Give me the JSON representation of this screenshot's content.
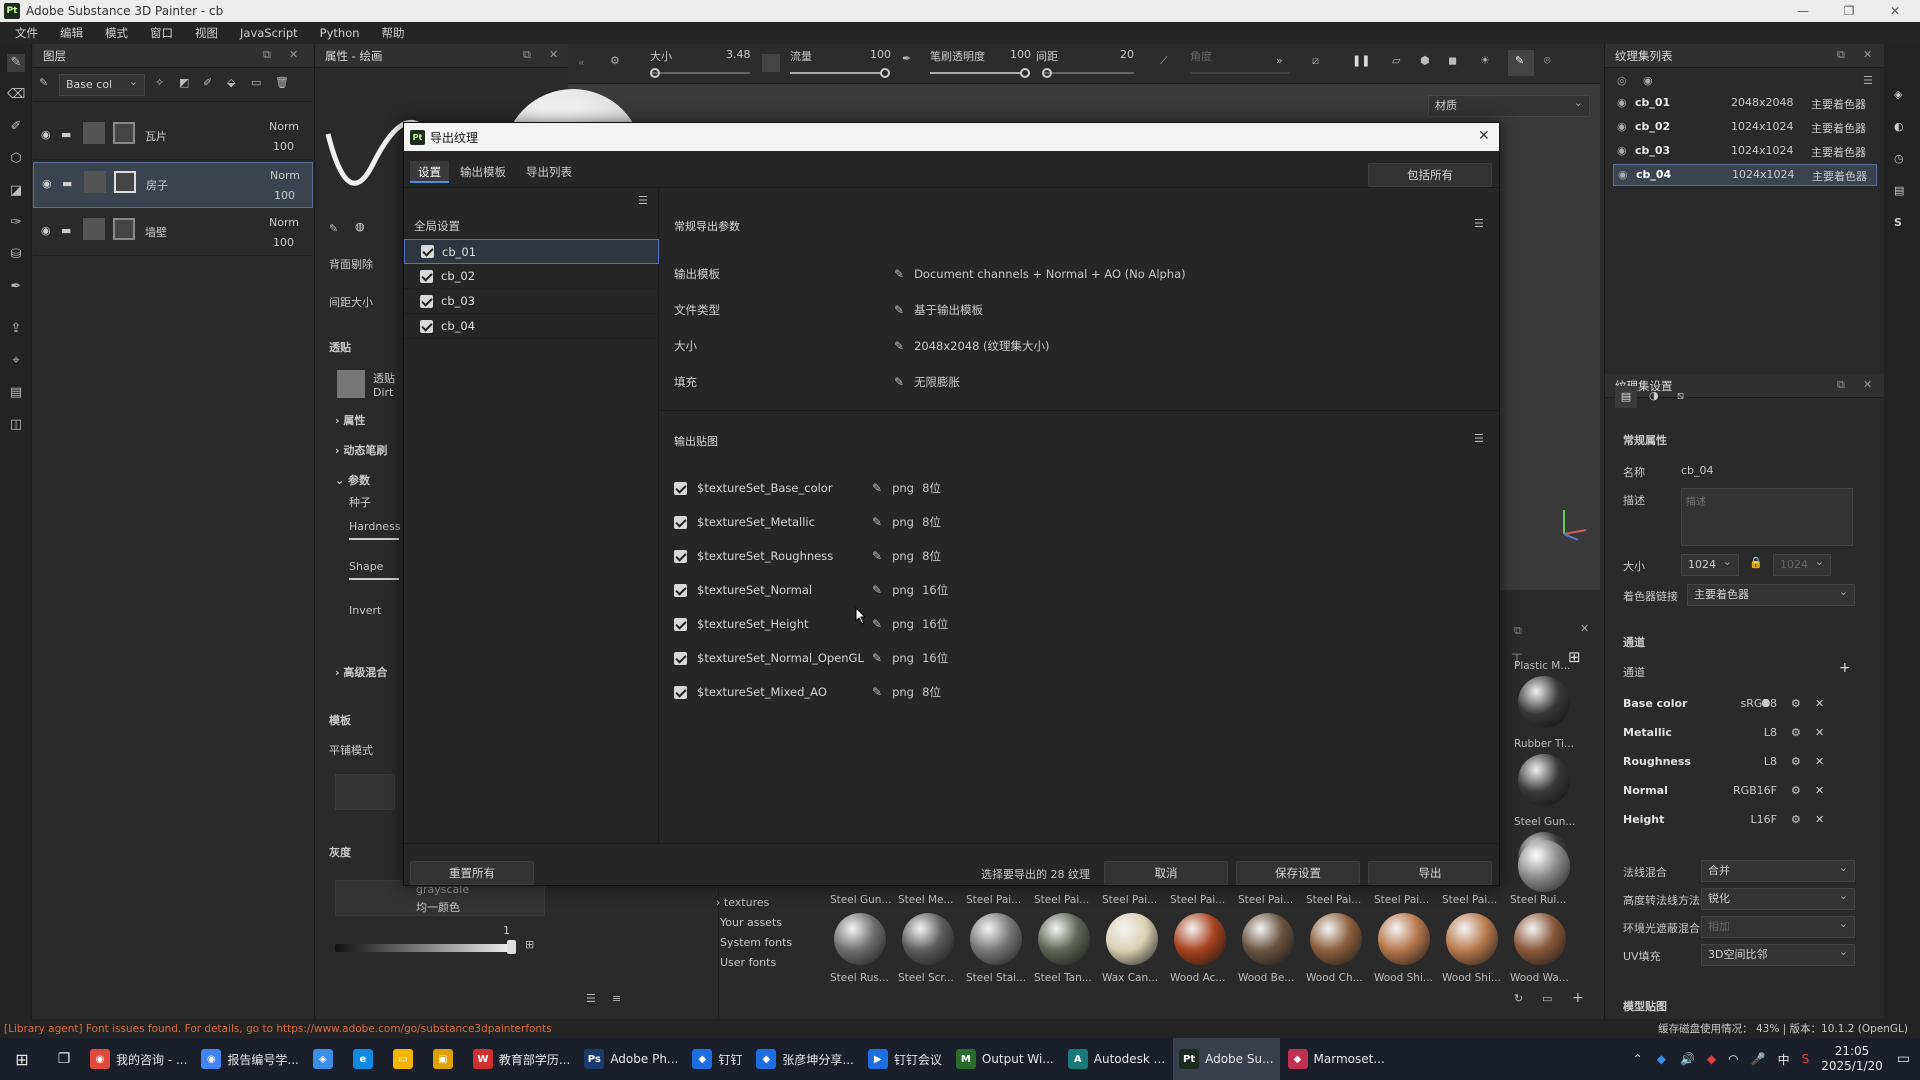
{
  "app": {
    "title": "Adobe Substance 3D Painter - cb",
    "logo": "Pt"
  },
  "menu": [
    "文件",
    "编辑",
    "模式",
    "窗口",
    "视图",
    "JavaScript",
    "Python",
    "帮助"
  ],
  "layers": {
    "panel_title": "图层",
    "channel_select": "Base col",
    "rows": [
      {
        "name": "瓦片",
        "blend": "Norm",
        "opacity": "100"
      },
      {
        "name": "房子",
        "blend": "Norm",
        "opacity": "100"
      },
      {
        "name": "墙壁",
        "blend": "Norm",
        "opacity": "100"
      }
    ]
  },
  "props": {
    "panel_title": "属性 - 绘画",
    "labels": [
      "背面剔除",
      "间距大小",
      "透贴",
      "属性",
      "动态笔刷",
      "参数",
      "种子",
      "Hardness",
      "Shape",
      "Invert",
      "高级混合",
      "模板",
      "平铺模式",
      "灰度"
    ],
    "stencil_title": "透贴",
    "stencil_sub": "Dirt",
    "gray_value": "1",
    "gray_text1": "grayscale",
    "gray_text2": "均一颜色"
  },
  "toolbar": {
    "size_label": "大小",
    "size_val": "3.48",
    "flow_label": "流量",
    "flow_val": "100",
    "opacity_label": "笔刷透明度",
    "opacity_val": "100",
    "spacing_label": "间距",
    "spacing_val": "20",
    "angle_label": "角度",
    "material_select": "材质"
  },
  "texture_list": {
    "title": "纹理集列表",
    "items": [
      {
        "name": "cb_01",
        "size": "2048x2048",
        "shader": "主要着色器"
      },
      {
        "name": "cb_02",
        "size": "1024x1024",
        "shader": "主要着色器"
      },
      {
        "name": "cb_03",
        "size": "1024x1024",
        "shader": "主要着色器"
      },
      {
        "name": "cb_04",
        "size": "1024x1024",
        "shader": "主要着色器"
      }
    ]
  },
  "texture_settings": {
    "title": "纹理集设置",
    "general": "常规属性",
    "name_label": "名称",
    "name_val": "cb_04",
    "desc_label": "描述",
    "desc_placeholder": "描述",
    "size_label": "大小",
    "size_val": "1024",
    "size_val2": "1024",
    "shader_label": "着色器链接",
    "shader_val": "主要着色器",
    "channels_title": "通道",
    "channels_label": "通道",
    "channels": [
      {
        "name": "Base color",
        "fmt": "sRGB8"
      },
      {
        "name": "Metallic",
        "fmt": "L8"
      },
      {
        "name": "Roughness",
        "fmt": "L8"
      },
      {
        "name": "Normal",
        "fmt": "RGB16F"
      },
      {
        "name": "Height",
        "fmt": "L16F"
      }
    ],
    "normal_mix_label": "法线混合",
    "normal_mix_val": "合并",
    "hmap_label": "高度转法线方法",
    "hmap_val": "锐化",
    "ao_label": "环境光遮蔽混合",
    "ao_val": "相加",
    "uv_label": "UV填充",
    "uv_val": "3D空间比邻",
    "model_maps": "模型贴图"
  },
  "dialog": {
    "title": "导出纹理",
    "tabs": [
      "设置",
      "输出模板",
      "导出列表"
    ],
    "include_all": "包括所有",
    "global_settings": "全局设置",
    "texture_sets": [
      "cb_01",
      "cb_02",
      "cb_03",
      "cb_04"
    ],
    "general_header": "常规导出参数",
    "params": [
      {
        "label": "输出模板",
        "value": "Document channels + Normal + AO (No Alpha)"
      },
      {
        "label": "文件类型",
        "value": "基于输出模板"
      },
      {
        "label": "大小",
        "value": "2048x2048  (纹理集大小)"
      },
      {
        "label": "填充",
        "value": "无限膨胀"
      }
    ],
    "maps_header": "输出贴图",
    "maps": [
      {
        "name": "$textureSet_Base_color",
        "fmt": "png",
        "bits": "8位"
      },
      {
        "name": "$textureSet_Metallic",
        "fmt": "png",
        "bits": "8位"
      },
      {
        "name": "$textureSet_Roughness",
        "fmt": "png",
        "bits": "8位"
      },
      {
        "name": "$textureSet_Normal",
        "fmt": "png",
        "bits": "16位"
      },
      {
        "name": "$textureSet_Height",
        "fmt": "png",
        "bits": "16位"
      },
      {
        "name": "$textureSet_Normal_OpenGL",
        "fmt": "png",
        "bits": "16位"
      },
      {
        "name": "$textureSet_Mixed_AO",
        "fmt": "png",
        "bits": "8位"
      }
    ],
    "reset_all": "重置所有",
    "selected_count": "选择要导出的 28 纹理",
    "cancel": "取消",
    "save_settings": "保存设置",
    "export": "导出"
  },
  "shelf": {
    "tree": [
      "textures",
      "Your assets",
      "System fonts",
      "User fonts"
    ],
    "bottom_row": [
      "Steel Rus...",
      "Steel Scr...",
      "Steel Stai...",
      "Steel Tan...",
      "Wax Can...",
      "Wood Ac...",
      "Wood Be...",
      "Wood Ch...",
      "Wood Shi...",
      "Wood Shi...",
      "Wood Wa..."
    ],
    "top_row": [
      "Steel Gun...",
      "Steel Me...",
      "Steel Pai...",
      "Steel Pai...",
      "Steel Pai...",
      "Steel Pai...",
      "Steel Pai...",
      "Steel Pai...",
      "Steel Pai...",
      "Steel Pai...",
      "Steel Rui..."
    ],
    "side_labels": [
      "Plastic M...",
      "Rubber Ti...",
      "Steel Gun..."
    ]
  },
  "status": {
    "message": "[Library agent] Font issues found. For details, go to https://www.adobe.com/go/substance3dpainterfonts",
    "right": "缓存磁盘使用情况：  43% | 版本：10.1.2 (OpenGL)"
  },
  "taskbar": {
    "items": [
      "我的咨询 - ...",
      "报告编号学...",
      "",
      "",
      "",
      "",
      "教育部学历...",
      "Adobe Ph...",
      "钉钉",
      "张彦坤分享...",
      "钉钉会议",
      "Output Wi...",
      "Autodesk ...",
      "Adobe Su...",
      "Marmoset..."
    ],
    "time": "21:05",
    "date": "2025/1/20",
    "ime": "中"
  },
  "colors": {
    "accent": "#4f8fe0",
    "selection": "#3c4350"
  }
}
